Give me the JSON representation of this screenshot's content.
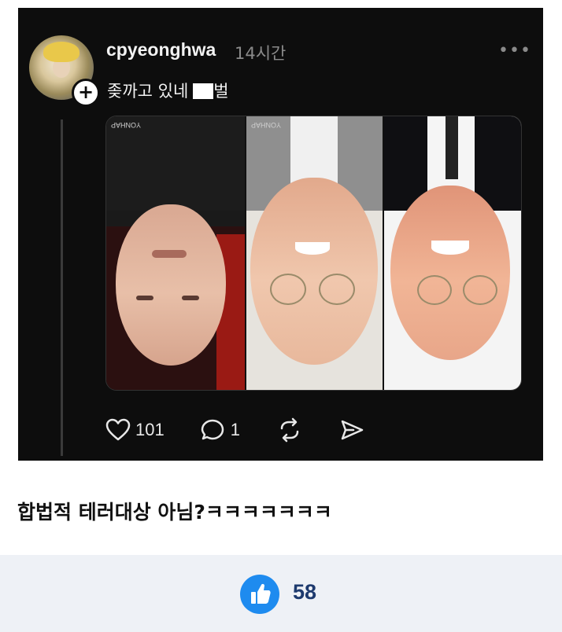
{
  "post": {
    "username": "cpyeonghwa",
    "timestamp": "14시간",
    "text": "좆까고 있네",
    "text_suffix": "벌",
    "media_watermark": "YONHAP",
    "likes": "101",
    "comments": "1"
  },
  "caption": "합법적 테러대상 아님?ㅋㅋㅋㅋㅋㅋㅋ",
  "footer": {
    "like_count": "58"
  },
  "colors": {
    "card_bg": "#0d0d0d",
    "like_blue": "#1e8bef",
    "count_navy": "#1d3a6e"
  },
  "icons": [
    "follow-plus-icon",
    "more-options-icon",
    "heart-icon",
    "comment-icon",
    "repost-icon",
    "share-icon",
    "thumbs-up-icon"
  ]
}
